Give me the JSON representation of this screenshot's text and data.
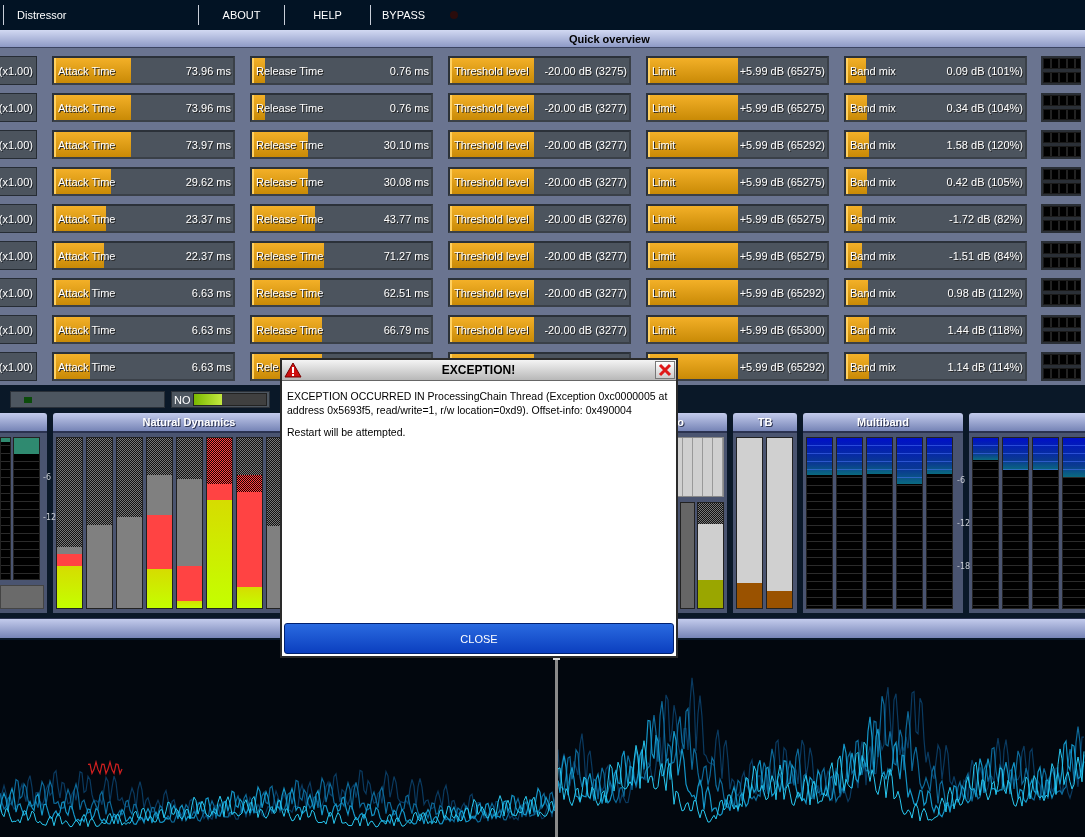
{
  "menu_bar": {
    "title": "Distressor",
    "items": [
      "ABOUT",
      "HELP",
      "BYPASS"
    ],
    "bypass_led": {
      "on": false
    }
  },
  "quick_overview": {
    "title": "Quick overview",
    "rows": [
      {
        "multiplier": "(x1.00)",
        "controls": [
          {
            "label": "Attack Time",
            "value": "73.96 ms",
            "level": 0.42
          },
          {
            "label": "Release Time",
            "value": "0.76 ms",
            "level": 0.06
          },
          {
            "label": "Threshold level",
            "value": "-20.00 dB (3275)",
            "level": 0.46
          },
          {
            "label": "Limit",
            "value": "+5.99 dB (65275)",
            "level": 0.49
          },
          {
            "label": "Band mix",
            "value": "0.09 dB (101%)",
            "level": 0.1
          }
        ]
      },
      {
        "multiplier": "(x1.00)",
        "controls": [
          {
            "label": "Attack Time",
            "value": "73.96 ms",
            "level": 0.42
          },
          {
            "label": "Release Time",
            "value": "0.76 ms",
            "level": 0.06
          },
          {
            "label": "Threshold level",
            "value": "-20.00 dB (3277)",
            "level": 0.46
          },
          {
            "label": "Limit",
            "value": "+5.99 dB (65275)",
            "level": 0.49
          },
          {
            "label": "Band mix",
            "value": "0.34 dB (104%)",
            "level": 0.105
          }
        ]
      },
      {
        "multiplier": "(x1.00)",
        "controls": [
          {
            "label": "Attack Time",
            "value": "73.97 ms",
            "level": 0.42
          },
          {
            "label": "Release Time",
            "value": "30.10 ms",
            "level": 0.3
          },
          {
            "label": "Threshold level",
            "value": "-20.00 dB (3277)",
            "level": 0.46
          },
          {
            "label": "Limit",
            "value": "+5.99 dB (65292)",
            "level": 0.49
          },
          {
            "label": "Band mix",
            "value": "1.58 dB (120%)",
            "level": 0.12
          }
        ]
      },
      {
        "multiplier": "(x1.00)",
        "controls": [
          {
            "label": "Attack Time",
            "value": "29.62 ms",
            "level": 0.31
          },
          {
            "label": "Release Time",
            "value": "30.08 ms",
            "level": 0.3
          },
          {
            "label": "Threshold level",
            "value": "-20.00 dB (3277)",
            "level": 0.46
          },
          {
            "label": "Limit",
            "value": "+5.99 dB (65275)",
            "level": 0.49
          },
          {
            "label": "Band mix",
            "value": "0.42 dB (105%)",
            "level": 0.105
          }
        ]
      },
      {
        "multiplier": "(x1.00)",
        "controls": [
          {
            "label": "Attack Time",
            "value": "23.37 ms",
            "level": 0.28
          },
          {
            "label": "Release Time",
            "value": "43.77 ms",
            "level": 0.34
          },
          {
            "label": "Threshold level",
            "value": "-20.00 dB (3276)",
            "level": 0.46
          },
          {
            "label": "Limit",
            "value": "+5.99 dB (65275)",
            "level": 0.49
          },
          {
            "label": "Band mix",
            "value": "-1.72 dB (82%)",
            "level": 0.08
          }
        ]
      },
      {
        "multiplier": "(x1.00)",
        "controls": [
          {
            "label": "Attack Time",
            "value": "22.37 ms",
            "level": 0.27
          },
          {
            "label": "Release Time",
            "value": "71.27 ms",
            "level": 0.39
          },
          {
            "label": "Threshold level",
            "value": "-20.00 dB (3277)",
            "level": 0.46
          },
          {
            "label": "Limit",
            "value": "+5.99 dB (65275)",
            "level": 0.49
          },
          {
            "label": "Band mix",
            "value": "-1.51 dB (84%)",
            "level": 0.08
          }
        ]
      },
      {
        "multiplier": "(x1.00)",
        "controls": [
          {
            "label": "Attack Time",
            "value": "6.63 ms",
            "level": 0.19
          },
          {
            "label": "Release Time",
            "value": "62.51 ms",
            "level": 0.37
          },
          {
            "label": "Threshold level",
            "value": "-20.00 dB (3277)",
            "level": 0.46
          },
          {
            "label": "Limit",
            "value": "+5.99 dB (65292)",
            "level": 0.49
          },
          {
            "label": "Band mix",
            "value": "0.98 dB (112%)",
            "level": 0.11
          }
        ]
      },
      {
        "multiplier": "(x1.00)",
        "controls": [
          {
            "label": "Attack Time",
            "value": "6.63 ms",
            "level": 0.19
          },
          {
            "label": "Release Time",
            "value": "66.79 ms",
            "level": 0.38
          },
          {
            "label": "Threshold level",
            "value": "-20.00 dB (3277)",
            "level": 0.46
          },
          {
            "label": "Limit",
            "value": "+5.99 dB (65300)",
            "level": 0.49
          },
          {
            "label": "Band mix",
            "value": "1.44 dB (118%)",
            "level": 0.115
          }
        ]
      },
      {
        "multiplier": "(x1.00)",
        "controls": [
          {
            "label": "Attack Time",
            "value": "6.63 ms",
            "level": 0.19
          },
          {
            "label": "Rele",
            "level": 0.38
          },
          {
            "level": 0.46
          },
          {
            "value": "+5.99 dB (65292)",
            "level": 0.49
          },
          {
            "label": "Band mix",
            "value": "1.14 dB (114%)",
            "level": 0.115
          }
        ]
      }
    ]
  },
  "status_strip": {
    "meter": {
      "label": "NO",
      "level": 0.39
    }
  },
  "meter_panels": [
    {
      "kind": "gr",
      "meters": [
        {
          "level": 0.03
        },
        {
          "level": 0.11
        }
      ],
      "scale": [
        "-6",
        "-12"
      ]
    },
    {
      "kind": "dynamics",
      "title": "Natural Dynamics",
      "bars": [
        {
          "layers": [
            {
              "kind": "gray",
              "level": 0.36
            },
            {
              "kind": "red",
              "level": 0.32
            },
            {
              "kind": "lime",
              "level": 0.25
            }
          ]
        },
        {
          "layers": [
            {
              "kind": "gray",
              "level": 0.49
            }
          ]
        },
        {
          "layers": [
            {
              "kind": "gray",
              "level": 0.535
            }
          ]
        },
        {
          "layers": [
            {
              "kind": "gray",
              "level": 0.78
            },
            {
              "kind": "red",
              "level": 0.545
            },
            {
              "kind": "lime",
              "level": 0.23
            }
          ]
        },
        {
          "layers": [
            {
              "kind": "gray",
              "level": 0.76
            },
            {
              "kind": "red",
              "level": 0.25
            },
            {
              "kind": "lime",
              "level": 0.04
            }
          ]
        },
        {
          "layers": [
            {
              "kind": "redhatch",
              "level": 1
            },
            {
              "kind": "red",
              "level": 0.73
            },
            {
              "kind": "lime",
              "level": 0.635
            }
          ]
        },
        {
          "layers": [
            {
              "kind": "redhatch",
              "level": 0.78
            },
            {
              "kind": "red",
              "level": 0.68
            },
            {
              "kind": "lime",
              "level": 0.125
            }
          ]
        },
        {
          "layers": [
            {
              "kind": "gray",
              "level": 0.48
            }
          ]
        }
      ]
    },
    {
      "kind": "stereo",
      "title": "o",
      "bars": [
        {
          "layers": [
            {
              "kind": "dark",
              "level": 1
            }
          ]
        },
        {
          "layers": [
            {
              "kind": "light",
              "level": 0.8
            },
            {
              "kind": "olive",
              "level": 0.27
            }
          ]
        }
      ]
    },
    {
      "kind": "tb",
      "title": "TB",
      "meters": [
        {
          "level": 0.15
        },
        {
          "level": 0.1
        }
      ]
    },
    {
      "kind": "multiband",
      "title": "Multiband",
      "meters": [
        {
          "level": 0.22
        },
        {
          "level": 0.22
        },
        {
          "level": 0.21
        },
        {
          "level": 0.27
        },
        {
          "level": 0.21
        }
      ],
      "scale": [
        "-6",
        "-12",
        "-18"
      ]
    },
    {
      "kind": "multiband",
      "meters": [
        {
          "level": 0.13
        },
        {
          "level": 0.19
        },
        {
          "level": 0.19
        },
        {
          "level": 0.23
        }
      ]
    }
  ],
  "dialog": {
    "title": "EXCEPTION!",
    "message": "EXCEPTION OCCURRED IN ProcessingChain Thread (Exception 0xc0000005 at address 0x5693f5, read/write=1, r/w location=0xd9). Offset-info: 0x490004",
    "note": "Restart will be attempted.",
    "button": "CLOSE"
  }
}
